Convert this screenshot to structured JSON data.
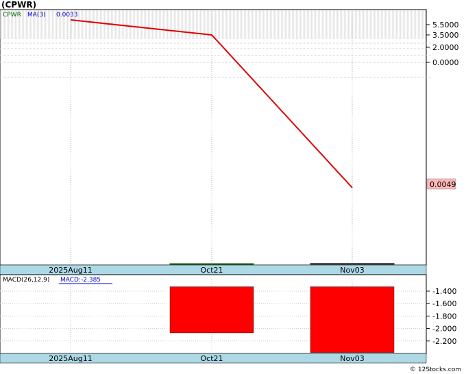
{
  "title": "(CPWR)",
  "footer": "© 12Stocks.com",
  "colors": {
    "up": "#226622",
    "down": "#ff0000",
    "ma": "#e00000",
    "date_bar": "#add8e6",
    "legend_symbol": "#006600",
    "legend_ma": "#0000cc",
    "price_box": "#ffb6b6"
  },
  "legend": {
    "symbol": "CPWR",
    "ma_label": "MA(3)",
    "ma_value": "0.0033"
  },
  "last_price": "0.0049",
  "macd_legend": {
    "label": "MACD(26,12,9)",
    "value_label": "MACD:-2.385"
  },
  "chart_data": [
    {
      "type": "candlestick",
      "title": "(CPWR)",
      "x_labels": [
        "2025Aug11",
        "Oct21",
        "Nov03"
      ],
      "y_ticks": [
        "5.5000",
        "3.5000",
        "2.0000",
        "0.0000"
      ],
      "candles": [
        {
          "date": "Oct21",
          "open": 0.0015,
          "high": 0.004,
          "low": 0.0001,
          "close": 0.003,
          "direction": "up"
        },
        {
          "date": "Nov03",
          "open": 0.007,
          "high": 0.007,
          "low": 0.0049,
          "close": 0.0049,
          "direction": "down"
        }
      ],
      "ma": {
        "name": "MA(3)",
        "points": [
          {
            "x": "2025Aug11",
            "y": 5.5
          },
          {
            "x": "Oct21",
            "y": 3.5
          },
          {
            "x": "Nov03",
            "y": 0.0033
          }
        ]
      },
      "last_value": 0.0049
    },
    {
      "type": "bar",
      "title": "MACD(26,12,9)",
      "x_labels": [
        "2025Aug11",
        "Oct21",
        "Nov03"
      ],
      "y_ticks": [
        "-1.400",
        "-1.600",
        "-1.800",
        "-2.000",
        "-2.200"
      ],
      "bars": [
        {
          "date": "Oct21",
          "top": -1.33,
          "bottom": -2.07
        },
        {
          "date": "Nov03",
          "top": -1.33,
          "bottom": -2.385
        }
      ]
    }
  ]
}
